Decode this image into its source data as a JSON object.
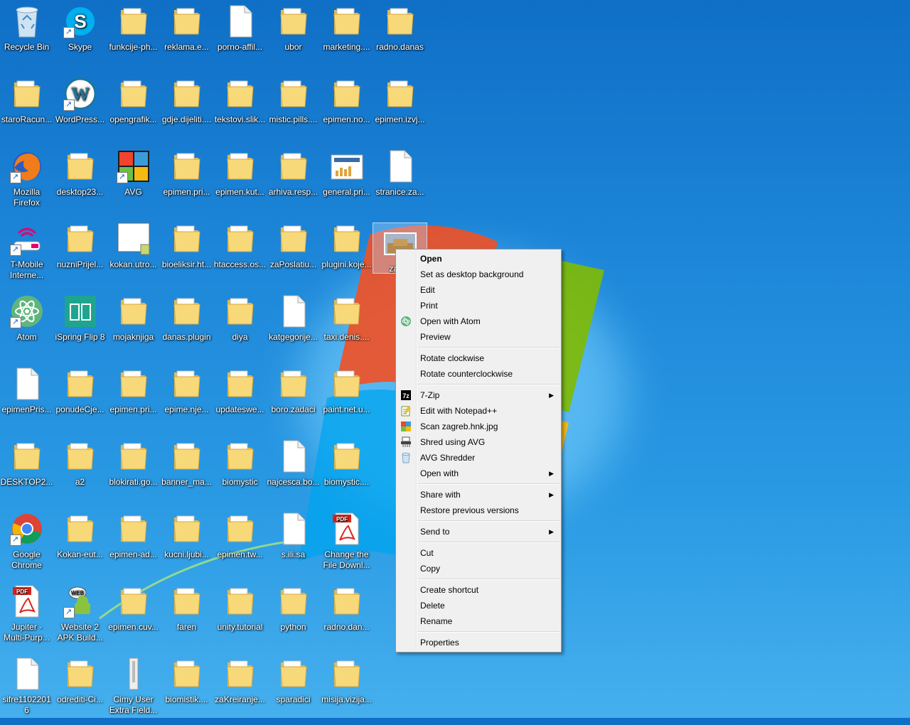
{
  "desktop": {
    "icons": [
      {
        "label": "Recycle Bin",
        "type": "bin"
      },
      {
        "label": "Skype",
        "type": "skype",
        "shortcut": true
      },
      {
        "label": "funkcije-ph...",
        "type": "folder"
      },
      {
        "label": "reklama.e...",
        "type": "folder"
      },
      {
        "label": "porno-affil...",
        "type": "file"
      },
      {
        "label": "ubor",
        "type": "folder"
      },
      {
        "label": "marketing....",
        "type": "folder"
      },
      {
        "label": "radno.danas",
        "type": "folder"
      },
      {
        "label": "staroRacun...",
        "type": "folder"
      },
      {
        "label": "WordPress...",
        "type": "wordpress",
        "shortcut": true
      },
      {
        "label": "opengrafik...",
        "type": "folder"
      },
      {
        "label": "gdje.dijeliti....",
        "type": "folder"
      },
      {
        "label": "tekstovi.slik...",
        "type": "folder"
      },
      {
        "label": "mistic.pills....",
        "type": "folder"
      },
      {
        "label": "epimen.no...",
        "type": "folder"
      },
      {
        "label": "epimen.izvj...",
        "type": "folder"
      },
      {
        "label": "Mozilla Firefox",
        "type": "firefox",
        "shortcut": true
      },
      {
        "label": "desktop23...",
        "type": "folder"
      },
      {
        "label": "AVG",
        "type": "avg",
        "shortcut": true
      },
      {
        "label": "epimen.pri...",
        "type": "folder"
      },
      {
        "label": "epimen.kut...",
        "type": "folder"
      },
      {
        "label": "arhiva.resp...",
        "type": "folder"
      },
      {
        "label": "general.pri...",
        "type": "image"
      },
      {
        "label": "stranice.za...",
        "type": "file"
      },
      {
        "label": "T-Mobile Interne...",
        "type": "tmobile",
        "shortcut": true
      },
      {
        "label": "nuzniPrijel...",
        "type": "folder"
      },
      {
        "label": "kokan.utro...",
        "type": "doc"
      },
      {
        "label": "bioeliksir.ht...",
        "type": "folder"
      },
      {
        "label": "htaccess.os...",
        "type": "folder"
      },
      {
        "label": "zaPoslatiu...",
        "type": "folder"
      },
      {
        "label": "plugini.koje...",
        "type": "folder"
      },
      {
        "label": "zagre",
        "type": "photo",
        "selected": true
      },
      {
        "label": "Atom",
        "type": "atom",
        "shortcut": true
      },
      {
        "label": "iSpring Flip 8",
        "type": "ispring"
      },
      {
        "label": "mojaknjiga",
        "type": "folder"
      },
      {
        "label": "danas.plugin",
        "type": "folder"
      },
      {
        "label": "diya",
        "type": "folder"
      },
      {
        "label": "katgegorije...",
        "type": "file"
      },
      {
        "label": "taxi.denis....",
        "type": "folder"
      },
      {
        "label": "",
        "type": "none"
      },
      {
        "label": "epimenPris...",
        "type": "file"
      },
      {
        "label": "ponudeCje...",
        "type": "folder"
      },
      {
        "label": "epimen.pri...",
        "type": "folder"
      },
      {
        "label": "epime.nje...",
        "type": "folder"
      },
      {
        "label": "updateswe...",
        "type": "folder"
      },
      {
        "label": "boro.zadaci",
        "type": "folder"
      },
      {
        "label": "paint.net.u...",
        "type": "folder"
      },
      {
        "label": "",
        "type": "none"
      },
      {
        "label": "DESKTOP2...",
        "type": "folder"
      },
      {
        "label": "a2",
        "type": "folder"
      },
      {
        "label": "blokirati.go...",
        "type": "folder"
      },
      {
        "label": "banner_ma...",
        "type": "folder"
      },
      {
        "label": "biomystic",
        "type": "folder"
      },
      {
        "label": "najcesca.bo...",
        "type": "file"
      },
      {
        "label": "biomystic....",
        "type": "folder"
      },
      {
        "label": "",
        "type": "none"
      },
      {
        "label": "Google Chrome",
        "type": "chrome",
        "shortcut": true
      },
      {
        "label": "Kokan-eut...",
        "type": "folder"
      },
      {
        "label": "epimen-ad...",
        "type": "folder"
      },
      {
        "label": "kucni.ljubi...",
        "type": "folder"
      },
      {
        "label": "epimen.tw...",
        "type": "folder"
      },
      {
        "label": "s.ili.sa",
        "type": "file"
      },
      {
        "label": "Change the File Downl...",
        "type": "pdf"
      },
      {
        "label": "",
        "type": "none"
      },
      {
        "label": "Jupiter - Multi-Purp...",
        "type": "pdf"
      },
      {
        "label": "Website 2 APK Build...",
        "type": "apk",
        "shortcut": true
      },
      {
        "label": "epimen.cuv...",
        "type": "folder"
      },
      {
        "label": "faren",
        "type": "folder"
      },
      {
        "label": "unity.tutorial",
        "type": "folder"
      },
      {
        "label": "python",
        "type": "folder"
      },
      {
        "label": "radno.dan...",
        "type": "folder"
      },
      {
        "label": "",
        "type": "none"
      },
      {
        "label": "sifre11022016",
        "type": "file"
      },
      {
        "label": "odrediti-Ci...",
        "type": "folder"
      },
      {
        "label": "Cimy User Extra Field...",
        "type": "zip"
      },
      {
        "label": "biomistik....",
        "type": "folder"
      },
      {
        "label": "zaKreiranje...",
        "type": "folder"
      },
      {
        "label": "sparadici",
        "type": "folder"
      },
      {
        "label": "misija.vizija...",
        "type": "folder"
      },
      {
        "label": "",
        "type": "none"
      }
    ]
  },
  "context_menu": {
    "groups": [
      [
        {
          "label": "Open",
          "bold": true
        },
        {
          "label": "Set as desktop background"
        },
        {
          "label": "Edit"
        },
        {
          "label": "Print"
        },
        {
          "label": "Open with Atom",
          "icon": "atom-icon"
        },
        {
          "label": "Preview"
        }
      ],
      [
        {
          "label": "Rotate clockwise"
        },
        {
          "label": "Rotate counterclockwise"
        }
      ],
      [
        {
          "label": "7-Zip",
          "icon": "7zip-icon",
          "submenu": true
        },
        {
          "label": "Edit with Notepad++",
          "icon": "notepadpp-icon"
        },
        {
          "label": "Scan zagreb.hnk.jpg",
          "icon": "avg-scan-icon"
        },
        {
          "label": "Shred using AVG",
          "icon": "shredder-icon"
        },
        {
          "label": "AVG Shredder",
          "icon": "avg-bin-icon"
        },
        {
          "label": "Open with",
          "submenu": true
        }
      ],
      [
        {
          "label": "Share with",
          "submenu": true
        },
        {
          "label": "Restore previous versions"
        }
      ],
      [
        {
          "label": "Send to",
          "submenu": true
        }
      ],
      [
        {
          "label": "Cut"
        },
        {
          "label": "Copy"
        }
      ],
      [
        {
          "label": "Create shortcut"
        },
        {
          "label": "Delete"
        },
        {
          "label": "Rename"
        }
      ],
      [
        {
          "label": "Properties"
        }
      ]
    ]
  }
}
